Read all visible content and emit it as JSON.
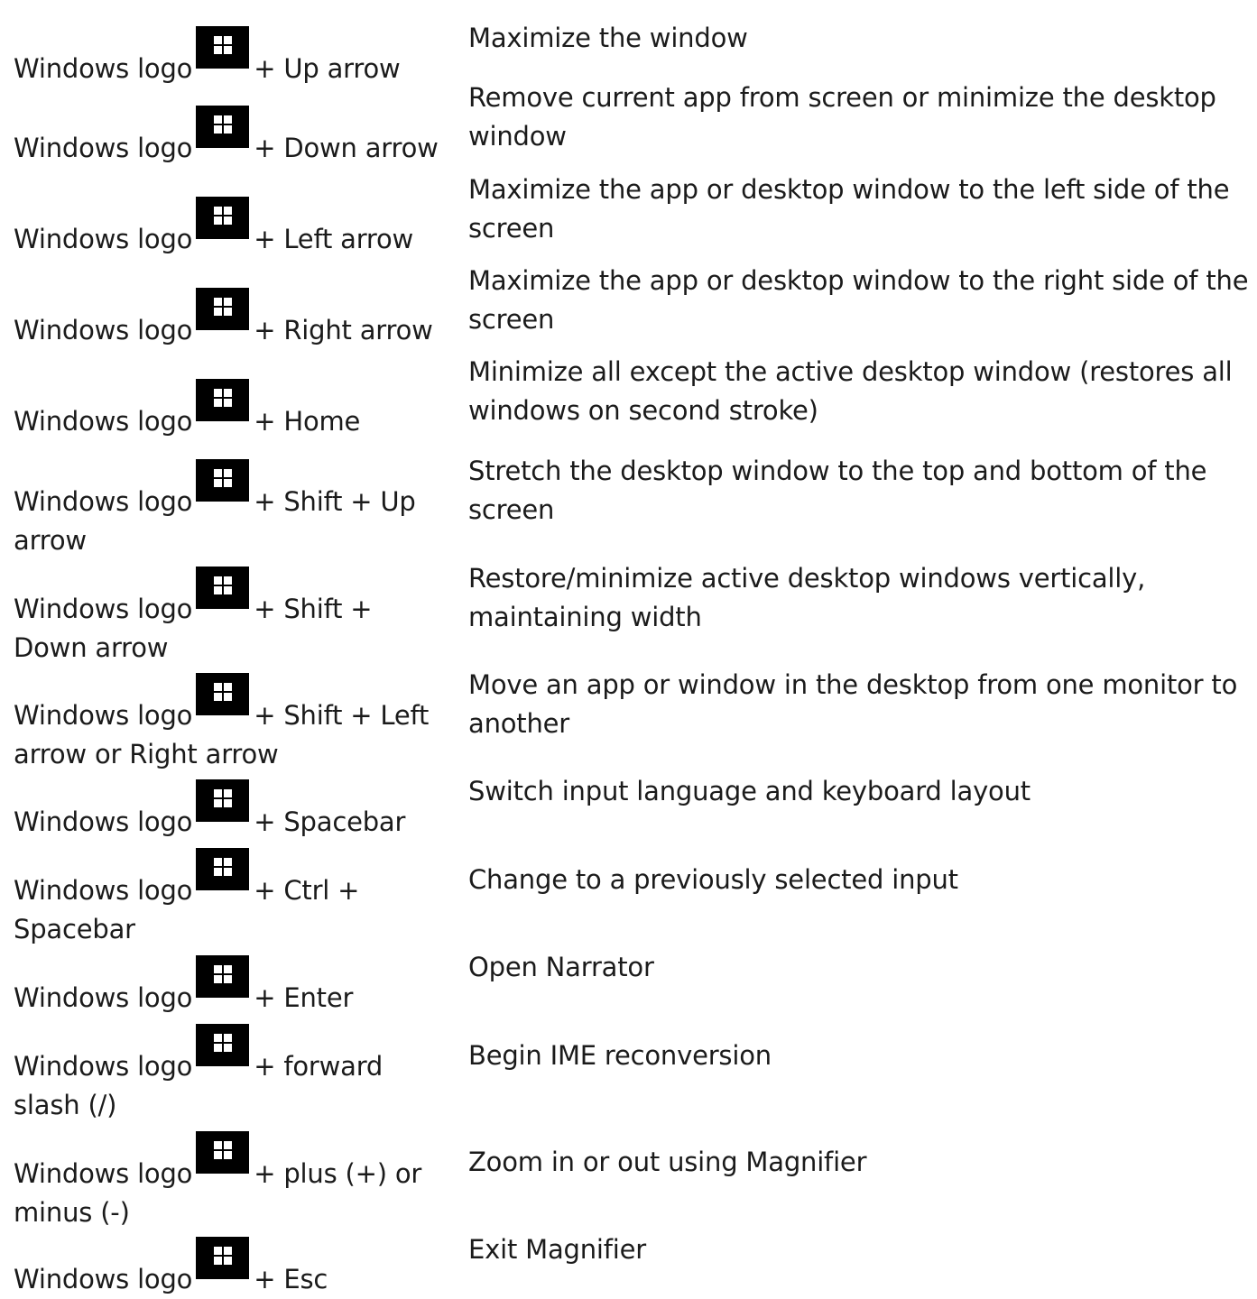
{
  "colors": {
    "text": "#1b1b1b",
    "logo_background": "#000000",
    "logo_glyph": "#ffffff"
  },
  "logo_icon": "windows-logo-icon",
  "shortcuts": [
    {
      "before": "Windows logo",
      "after": "+ Up arrow",
      "after_2": "",
      "desc": "Maximize the window",
      "desc_2": ""
    },
    {
      "before": "Windows logo",
      "after": "+ Down arrow",
      "after_2": "",
      "desc": "Remove current app from screen or minimize the desktop",
      "desc_2": "window"
    },
    {
      "before": "Windows logo",
      "after": "+ Left arrow",
      "after_2": "",
      "desc": "Maximize the app or desktop window to the left side of the",
      "desc_2": "screen"
    },
    {
      "before": "Windows logo",
      "after": "+ Right arrow",
      "after_2": "",
      "desc": "Maximize the app or desktop window to the right side of the",
      "desc_2": "screen"
    },
    {
      "before": "Windows logo",
      "after": "+ Home",
      "after_2": "",
      "desc": "Minimize all except the active desktop window (restores all",
      "desc_2": "windows on second stroke)"
    },
    {
      "before": "Windows logo",
      "after": "+ Shift + Up",
      "after_2": "arrow",
      "desc": "Stretch the desktop window to the top and bottom of the",
      "desc_2": "screen"
    },
    {
      "before": "Windows logo",
      "after": "+ Shift +",
      "after_2": "Down arrow",
      "desc": "Restore/minimize active desktop windows vertically,",
      "desc_2": "maintaining width"
    },
    {
      "before": "Windows logo",
      "after": "+ Shift + Left",
      "after_2": "arrow or Right arrow",
      "desc": "Move an app or window in the desktop from one monitor to",
      "desc_2": "another"
    },
    {
      "before": "Windows logo",
      "after": "+ Spacebar",
      "after_2": "",
      "desc": "Switch input language and keyboard layout",
      "desc_2": ""
    },
    {
      "before": "Windows logo",
      "after": "+ Ctrl +",
      "after_2": "Spacebar",
      "desc": "Change to a previously selected input",
      "desc_2": ""
    },
    {
      "before": "Windows logo",
      "after": "+ Enter",
      "after_2": "",
      "desc": "Open Narrator",
      "desc_2": ""
    },
    {
      "before": "Windows logo",
      "after": "+ forward",
      "after_2": "slash (/)",
      "desc": "Begin IME reconversion",
      "desc_2": ""
    },
    {
      "before": "Windows logo",
      "after": "+ plus (+) or",
      "after_2": "minus (-)",
      "desc": "Zoom in or out using Magnifier",
      "desc_2": ""
    },
    {
      "before": "Windows logo",
      "after": "+ Esc",
      "after_2": "",
      "desc": "Exit Magnifier",
      "desc_2": ""
    }
  ]
}
